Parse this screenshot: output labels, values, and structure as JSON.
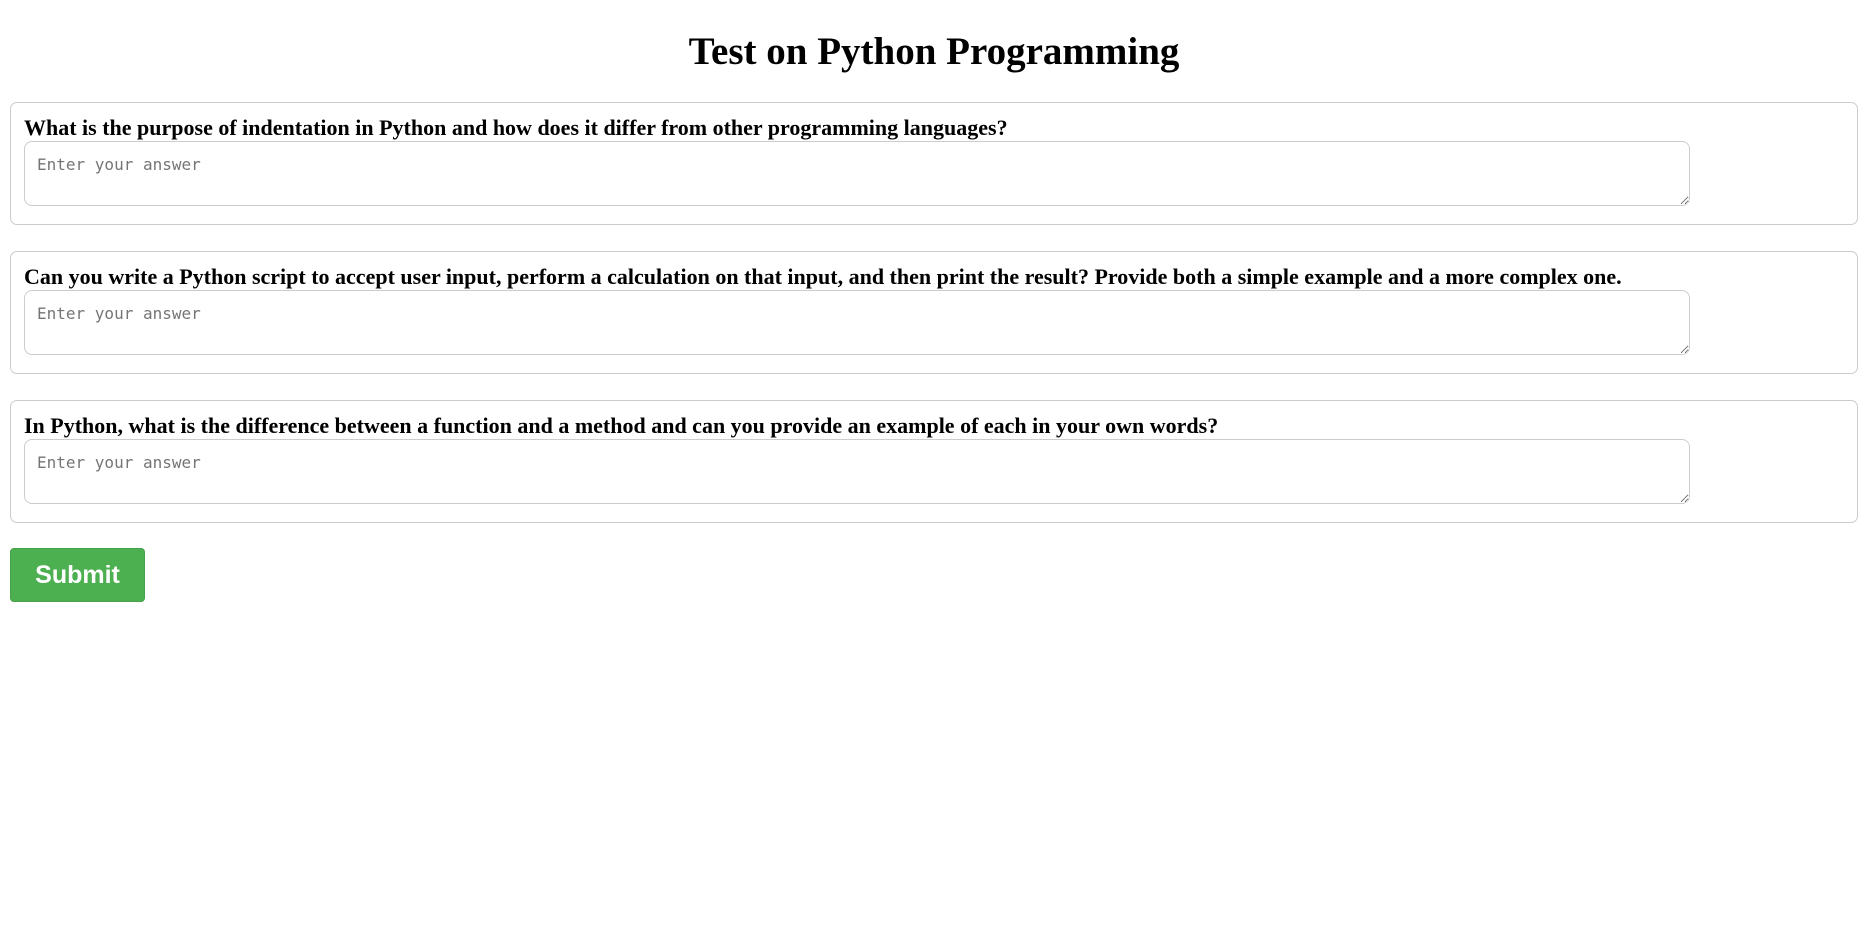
{
  "page": {
    "title": "Test on Python Programming"
  },
  "questions": [
    {
      "label": "What is the purpose of indentation in Python and how does it differ from other programming languages?",
      "placeholder": "Enter your answer",
      "value": ""
    },
    {
      "label": "Can you write a Python script to accept user input, perform a calculation on that input, and then print the result? Provide both a simple example and a more complex one.",
      "placeholder": "Enter your answer",
      "value": ""
    },
    {
      "label": "In Python, what is the difference between a function and a method and can you provide an example of each in your own words?",
      "placeholder": "Enter your answer",
      "value": ""
    }
  ],
  "form": {
    "submit_label": "Submit"
  },
  "colors": {
    "submit_background": "#4caf50",
    "submit_text": "#ffffff",
    "border": "#cccccc"
  }
}
